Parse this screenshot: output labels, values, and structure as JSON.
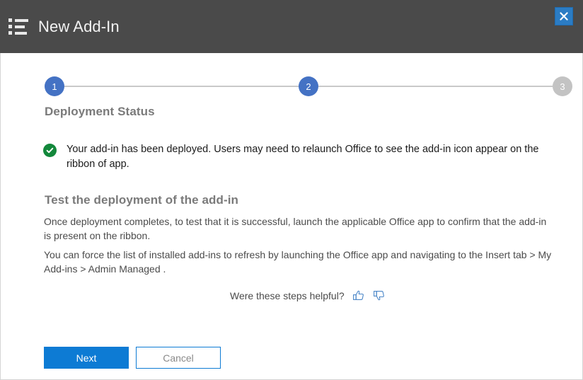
{
  "header": {
    "title": "New Add-In",
    "icon": "list-icon",
    "close_icon": "close-icon",
    "background_color": "#4a4a4a",
    "close_color": "#2b7cc4"
  },
  "stepper": {
    "steps": [
      {
        "label": "1",
        "state": "active"
      },
      {
        "label": "2",
        "state": "active"
      },
      {
        "label": "3",
        "state": "inactive"
      }
    ],
    "active_color": "#4472c4",
    "inactive_color": "#c3c3c3",
    "line_color": "#c9c9c9"
  },
  "main": {
    "deployment_title": "Deployment Status",
    "status": {
      "icon": "success-check-icon",
      "icon_color": "#13883b",
      "message": "Your add-in has been deployed. Users may need to relaunch Office to see the add-in icon appear on the ribbon of app."
    },
    "test_title": "Test the deployment of the add-in",
    "paragraph_1": "Once deployment completes, to test that it is successful, launch the applicable Office app to confirm that the add-in is present on the ribbon.",
    "paragraph_2": "You can force the list of installed add-ins to refresh by launching the Office app and navigating to the Insert tab > My Add-ins > Admin Managed ."
  },
  "feedback": {
    "question": "Were these steps helpful?",
    "thumbs_up_icon": "thumbs-up-icon",
    "thumbs_down_icon": "thumbs-down-icon",
    "icon_color": "#4a86c8"
  },
  "footer": {
    "next_label": "Next",
    "cancel_label": "Cancel",
    "primary_color": "#0d7bd4"
  }
}
